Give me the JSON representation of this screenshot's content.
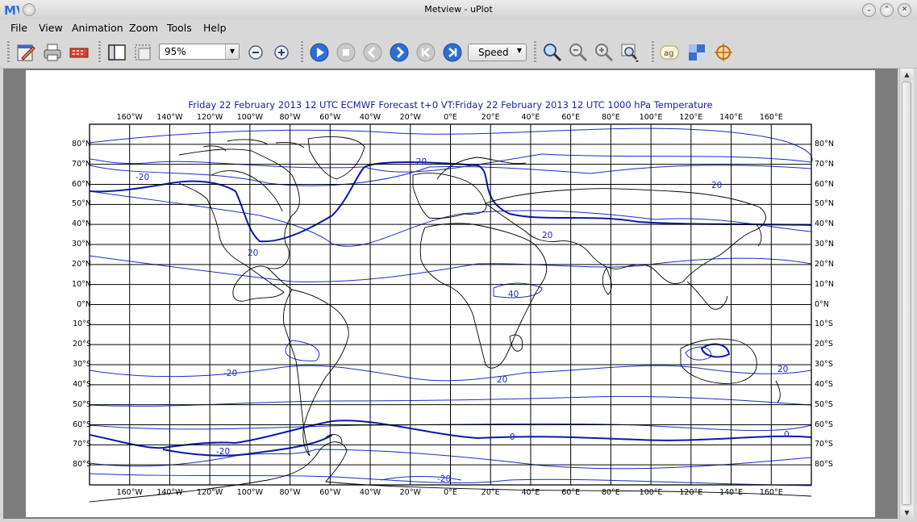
{
  "window": {
    "title": "Metview - uPlot",
    "logo_text": "MV",
    "controls": [
      "minimize-icon",
      "maximize-icon",
      "close-icon"
    ]
  },
  "menu": {
    "items": [
      {
        "label": "File",
        "accel": "F"
      },
      {
        "label": "View",
        "accel": "V"
      },
      {
        "label": "Animation",
        "accel": "A"
      },
      {
        "label": "Zoom",
        "accel": "Z"
      },
      {
        "label": "Tools",
        "accel": "T"
      },
      {
        "label": "Help",
        "accel": "H"
      }
    ]
  },
  "toolbar": {
    "icons": [
      "edit-icon",
      "print-icon",
      "export-icon",
      "sidebar-icon",
      "select-area-icon",
      "zoom-out-icon",
      "zoom-in-icon",
      "play-icon",
      "stop-icon",
      "previous-icon",
      "next-icon",
      "first-icon",
      "last-icon",
      "magnifier-icon",
      "zoom-out-magnifier-icon",
      "zoom-in-magnifier-icon",
      "zoom-area-icon",
      "text-label-icon",
      "grid-icon",
      "cursor-data-icon"
    ],
    "zoom_value": "95%",
    "speed_label": "Speed"
  },
  "plot": {
    "title": "Friday 22 February 2013 12 UTC ECMWF Forecast t+0 VT:Friday 22 February 2013 12 UTC 1000 hPa  Temperature",
    "lon_labels": [
      "160°W",
      "140°W",
      "120°W",
      "100°W",
      "80°W",
      "60°W",
      "40°W",
      "20°W",
      "0°E",
      "20°E",
      "40°E",
      "60°E",
      "80°E",
      "100°E",
      "120°E",
      "140°E",
      "160°E"
    ],
    "lat_labels": [
      "80°N",
      "70°N",
      "60°N",
      "50°N",
      "40°N",
      "30°N",
      "20°N",
      "10°N",
      "0°N",
      "10°S",
      "20°S",
      "30°S",
      "40°S",
      "50°S",
      "60°S",
      "70°S",
      "80°S"
    ],
    "contour_labels": [
      "-20",
      "-20",
      "20",
      "40",
      "20",
      "20",
      "-20",
      "20",
      "20",
      "0",
      "0",
      "-20",
      "-20"
    ],
    "contour_color": "#1c2cc7",
    "thick_contour_color": "#0a1aa8"
  }
}
